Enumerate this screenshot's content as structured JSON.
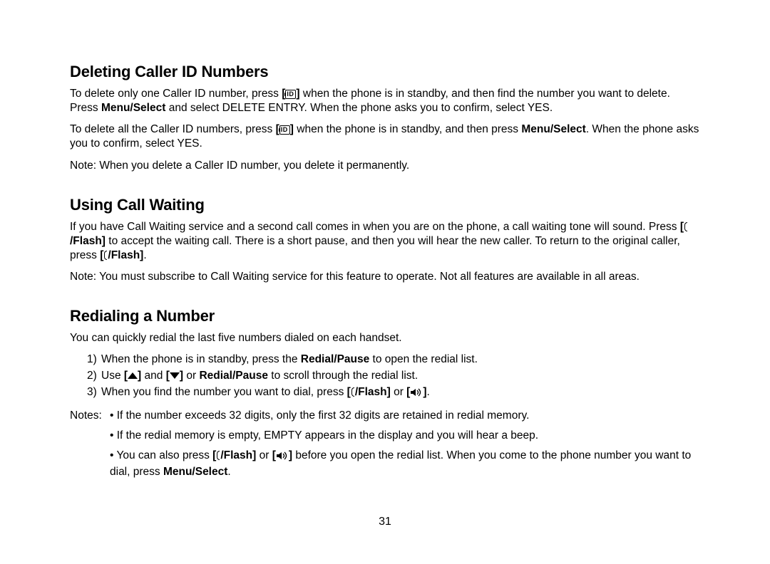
{
  "page_number": "31",
  "sections": {
    "s1": {
      "heading": "Deleting Caller ID Numbers",
      "p1a": "To delete only one Caller ID number, press ",
      "p1b": " when the phone is in standby, and then find the number you want to delete. Press ",
      "p1_bold1": "Menu/Select",
      "p1c": " and select DELETE ENTRY. When the phone asks you to confirm, select YES.",
      "p2a": "To delete all the Caller ID numbers, press ",
      "p2b": " when the phone is in standby, and then press ",
      "p2_bold1": "Menu/Select",
      "p2c": ". When the phone asks you to confirm, select YES.",
      "p3": "Note: When you delete a Caller ID number, you delete it permanently."
    },
    "s2": {
      "heading": "Using Call Waiting",
      "p1a": "If you have Call Waiting service and a second call comes in when you are on the phone, a call waiting tone will sound. Press ",
      "p1_bold1": "/Flash]",
      "p1b": " to accept the waiting call. There is a short pause, and then you will hear the new caller. To return to the original caller, press ",
      "p1_bold2": "/Flash]",
      "p1c": ".",
      "p2": "Note: You must subscribe to Call Waiting service for this feature to operate. Not all features are available in all areas."
    },
    "s3": {
      "heading": "Redialing a Number",
      "p1": "You can quickly redial the last five numbers dialed on each handset.",
      "li1a": "When the phone is in standby, press the ",
      "li1_bold": "Redial/Pause",
      "li1b": " to open the redial list.",
      "li2a": "Use ",
      "li2b": " and ",
      "li2c": " or ",
      "li2_bold": "Redial/Pause",
      "li2d": " to scroll through the redial list.",
      "li3a": "When you find the number you want to dial, press ",
      "li3_bold": "/Flash]",
      "li3b": " or ",
      "li3c": ".",
      "notes_label": "Notes:",
      "n1": "If the number exceeds 32 digits, only the first 32 digits are retained in redial memory.",
      "n2": "If the redial memory is empty, EMPTY appears in the display and you will hear a beep.",
      "n3a": "You can also press ",
      "n3_bold1": "/Flash]",
      "n3b": " or ",
      "n3c": " before you open the redial list. When you come to the phone number you want to dial, press ",
      "n3_bold2": "Menu/Select",
      "n3d": "."
    }
  },
  "icons": {
    "id_bracket_open": "[",
    "id_bracket_close": "]",
    "id_text": "ID",
    "bracket_open": "[",
    "bracket_close": "]",
    "bullet": "• "
  }
}
